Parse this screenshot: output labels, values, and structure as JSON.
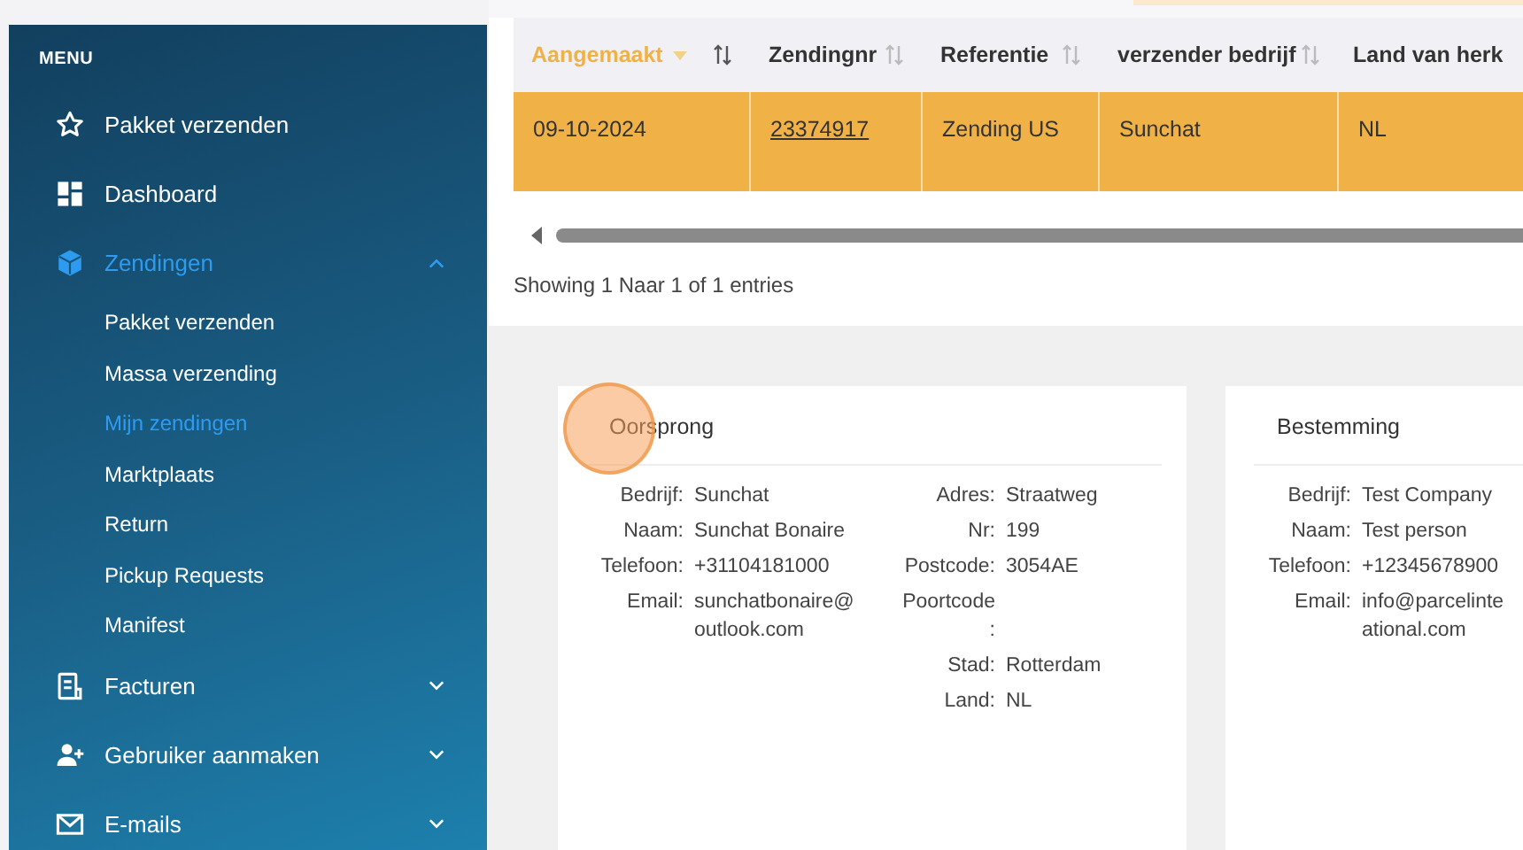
{
  "sidebar": {
    "heading": "MENU",
    "items": [
      {
        "label": "Pakket verzenden",
        "selected": false
      },
      {
        "label": "Dashboard",
        "selected": false
      },
      {
        "label": "Zendingen",
        "selected": true,
        "expanded": true,
        "children": [
          {
            "label": "Pakket verzenden",
            "selected": false
          },
          {
            "label": "Massa verzending",
            "selected": false
          },
          {
            "label": "Mijn zendingen",
            "selected": true
          },
          {
            "label": "Marktplaats",
            "selected": false
          },
          {
            "label": "Return",
            "selected": false
          },
          {
            "label": "Pickup Requests",
            "selected": false
          },
          {
            "label": "Manifest",
            "selected": false
          }
        ]
      },
      {
        "label": "Facturen",
        "selected": false,
        "expanded": false
      },
      {
        "label": "Gebruiker aanmaken",
        "selected": false,
        "expanded": false
      },
      {
        "label": "E-mails",
        "selected": false,
        "expanded": false
      }
    ]
  },
  "table": {
    "columns": [
      {
        "label": "Aangemaakt",
        "sorted": true
      },
      {
        "label": "Zendingnr",
        "sorted": false
      },
      {
        "label": "Referentie",
        "sorted": false
      },
      {
        "label": "verzender bedrijf",
        "sorted": false
      },
      {
        "label": "Land van herk",
        "sorted": false
      }
    ],
    "rows": [
      {
        "selected": true,
        "cells": [
          {
            "text": "09-10-2024",
            "kind": "text"
          },
          {
            "text": "23374917",
            "kind": "link"
          },
          {
            "text": "Zending US",
            "kind": "text"
          },
          {
            "text": "Sunchat",
            "kind": "text"
          },
          {
            "text": "NL",
            "kind": "text"
          }
        ]
      }
    ],
    "info": "Showing 1 Naar 1 of 1 entries"
  },
  "cards": [
    {
      "title": "Oorsprong",
      "columns": [
        [
          {
            "label": "Bedrijf:",
            "lines": [
              "Sunchat"
            ]
          },
          {
            "label": "Naam:",
            "lines": [
              "Sunchat Bonaire"
            ]
          },
          {
            "label": "Telefoon:",
            "lines": [
              "+31104181000"
            ]
          },
          {
            "label": "Email:",
            "lines": [
              "sunchatbonaire@",
              "outlook.com"
            ]
          }
        ],
        [
          {
            "label": "Adres:",
            "lines": [
              "Straatweg"
            ]
          },
          {
            "label": "Nr:",
            "lines": [
              "199"
            ]
          },
          {
            "label": "Postcode:",
            "lines": [
              "3054AE"
            ]
          },
          {
            "label": "Poortcode :"
          },
          {
            "label": "Stad:",
            "lines": [
              "Rotterdam"
            ]
          },
          {
            "label": "Land:",
            "lines": [
              "NL"
            ]
          }
        ]
      ]
    },
    {
      "title": "Bestemming",
      "columns": [
        [
          {
            "label": "Bedrijf:",
            "lines": [
              "Test Company"
            ]
          },
          {
            "label": "Naam:",
            "lines": [
              "Test person"
            ]
          },
          {
            "label": "Telefoon:",
            "lines": [
              "+12345678900"
            ]
          },
          {
            "label": "Email:",
            "lines": [
              "info@parcelinte",
              "ational.com"
            ]
          }
        ]
      ]
    }
  ],
  "click_marker": {
    "kind": "click"
  }
}
